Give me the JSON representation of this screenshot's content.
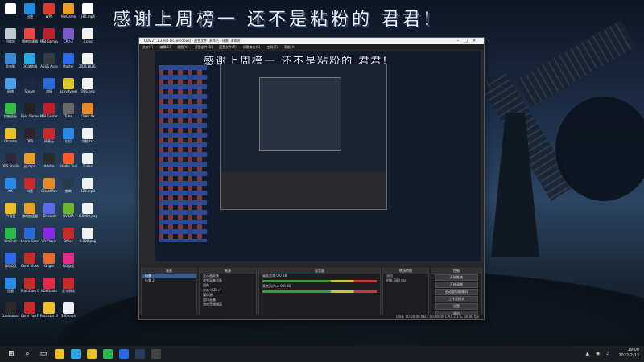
{
  "overlay_title": "感谢上周榜一 还不是粘粉的 君君!",
  "desktop": {
    "icons": [
      {
        "label": "",
        "color": "#ffffff"
      },
      {
        "label": "迅雷",
        "color": "#1a8fe3"
      },
      {
        "label": "WPS",
        "color": "#d83a2c"
      },
      {
        "label": "WeGame",
        "color": "#e8a02a"
      },
      {
        "label": "985.mp4",
        "color": "#ffffff"
      },
      {
        "label": "回收站",
        "color": "#c0c8d0"
      },
      {
        "label": "雷神加速器",
        "color": "#e84545"
      },
      {
        "label": "MSI Gaming APP",
        "color": "#c0202a"
      },
      {
        "label": "CPU-Z",
        "color": "#7a5ac8"
      },
      {
        "label": "3.png",
        "color": "#f0f0f0"
      },
      {
        "label": "此电脑",
        "color": "#3a8ad8"
      },
      {
        "label": "QQ浏览器",
        "color": "#2aa6e8"
      },
      {
        "label": "ASUS Aura",
        "color": "#333a44"
      },
      {
        "label": "Master",
        "color": "#2a6ae8"
      },
      {
        "label": "20211020.png",
        "color": "#f0f0f0"
      },
      {
        "label": "网络",
        "color": "#4aa0e8"
      },
      {
        "label": "Steam",
        "color": "#1a2a44"
      },
      {
        "label": "战网",
        "color": "#2a6ad8"
      },
      {
        "label": "activity.exe",
        "color": "#d8c82a"
      },
      {
        "label": "OBS.png",
        "color": "#f0f0f0"
      },
      {
        "label": "控制面板",
        "color": "#3ab84a"
      },
      {
        "label": "Epic Games",
        "color": "#222222"
      },
      {
        "label": "MSI Center",
        "color": "#c0202a"
      },
      {
        "label": "Tube",
        "color": "#6a6a6a"
      },
      {
        "label": "CPHU.fix",
        "color": "#e88a2a"
      },
      {
        "label": "Chrome",
        "color": "#e8c02a"
      },
      {
        "label": "OBS",
        "color": "#302030"
      },
      {
        "label": "网易云",
        "color": "#c82a2a"
      },
      {
        "label": "钉钉",
        "color": "#2a8ae8"
      },
      {
        "label": "文档.txt",
        "color": "#f0f0f0"
      },
      {
        "label": "OBS Studio",
        "color": "#2a2a3a"
      },
      {
        "label": "yy.mp4",
        "color": "#e8a02a"
      },
      {
        "label": "Adobe",
        "color": "#2a2a2a"
      },
      {
        "label": "Studio Tools",
        "color": "#ff5a2a"
      },
      {
        "label": "5.xlsx",
        "color": "#f0f0f0"
      },
      {
        "label": "KK",
        "color": "#2a8ae8"
      },
      {
        "label": "抖音",
        "color": "#c82a2a"
      },
      {
        "label": "GlassWire",
        "color": "#e88a2a"
      },
      {
        "label": "剪映",
        "color": "#2a3a4a"
      },
      {
        "label": "123.mp3",
        "color": "#f0f0f0"
      },
      {
        "label": "YY语音",
        "color": "#e8c02a"
      },
      {
        "label": "游戏加速器",
        "color": "#e8a02a"
      },
      {
        "label": "Discord",
        "color": "#5a6ae8"
      },
      {
        "label": "NVIDIA",
        "color": "#6ab82a"
      },
      {
        "label": "0.0000.png",
        "color": "#f0f0f0"
      },
      {
        "label": "WeChat",
        "color": "#2ab84a"
      },
      {
        "label": "Learn Corel VideoStudio",
        "color": "#2a6ad8"
      },
      {
        "label": "VR Player",
        "color": "#8a2ae8"
      },
      {
        "label": "Office",
        "color": "#c82a2a"
      },
      {
        "label": "0.000.png",
        "color": "#f0f0f0"
      },
      {
        "label": "腾讯QQ",
        "color": "#2a6ae8"
      },
      {
        "label": "Corel VideoStudio",
        "color": "#c82a2a"
      },
      {
        "label": "Origin",
        "color": "#e86a2a"
      },
      {
        "label": "QQ游戏",
        "color": "#e82a8a"
      },
      {
        "label": "",
        "color": "transparent"
      },
      {
        "label": "迅雷",
        "color": "#2a8ae8"
      },
      {
        "label": "MultiCam Capture Lite",
        "color": "#c82a2a"
      },
      {
        "label": "KOKOdolo",
        "color": "#e82a4a"
      },
      {
        "label": "显卡测试",
        "color": "#c82a2a"
      },
      {
        "label": "",
        "color": "transparent"
      },
      {
        "label": "Dashboard",
        "color": "#2a2a2a"
      },
      {
        "label": "Corel FastFlick",
        "color": "#c82a2a"
      },
      {
        "label": "Rockstar Games",
        "color": "#f0c02a"
      },
      {
        "label": "360.mp4",
        "color": "#f0f0f0"
      },
      {
        "label": "",
        "color": "transparent"
      }
    ]
  },
  "obs": {
    "title": "OBS 27.1.3 (64-bit, windows) - 配置文件: 未命名 - 场景: 未命名",
    "menu": [
      "文件(F)",
      "编辑(E)",
      "视图(V)",
      "停靠部件(D)",
      "配置文件(P)",
      "场景集合(S)",
      "工具(T)",
      "帮助(H)"
    ],
    "preview_title": "感谢上周榜一 还不是粘粉的 君君!",
    "docks": {
      "scenes": {
        "header": "场景",
        "items": [
          "场景",
          "场景 2"
        ]
      },
      "sources": {
        "header": "来源",
        "items": [
          "显示器采集",
          "视频采集设备",
          "图像",
          "文本 (GDI+)",
          "媒体源",
          "窗口采集",
          "游戏音频捕获"
        ]
      },
      "mixer": {
        "header": "混音器",
        "items": [
          "桌面音频 0.0 dB",
          "麦克风/Aux 0.0 dB"
        ]
      },
      "transitions": {
        "header": "转场特效",
        "items": [
          "淡出",
          "时长 300 ms"
        ]
      },
      "controls": {
        "header": "控制",
        "buttons": [
          "开始推流",
          "开始录制",
          "启动虚拟摄像机",
          "工作室模式",
          "设置",
          "退出"
        ]
      }
    },
    "status": "LIVE: 00:00:00  REC: 00:00:00  CPU: 2.1%, 60.00 fps"
  },
  "taskbar": {
    "icons": [
      {
        "name": "windows-start-icon",
        "color": "#ffffff"
      },
      {
        "name": "search-icon",
        "color": "#ffffff"
      },
      {
        "name": "task-view-icon",
        "color": "#ffffff"
      },
      {
        "name": "file-explorer-icon",
        "color": "#f0c02a"
      },
      {
        "name": "edge-icon",
        "color": "#2aa6e8"
      },
      {
        "name": "chrome-icon",
        "color": "#e8c02a"
      },
      {
        "name": "wechat-icon",
        "color": "#2ab84a"
      },
      {
        "name": "qq-icon",
        "color": "#2a6ae8"
      },
      {
        "name": "steam-icon",
        "color": "#2a3a5a"
      },
      {
        "name": "obs-icon",
        "color": "#444"
      }
    ],
    "time": "19:00",
    "date": "2022/2/13"
  }
}
